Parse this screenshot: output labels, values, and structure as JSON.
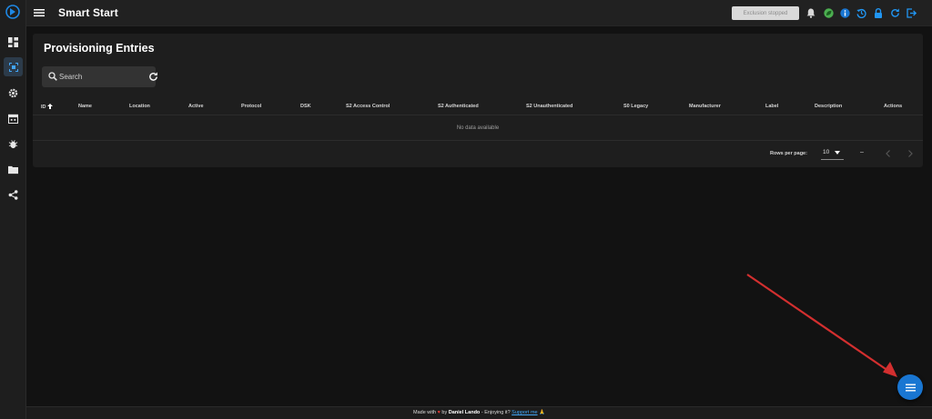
{
  "app": {
    "title": "Smart Start"
  },
  "topbar": {
    "exclusion_label": "Exclusion stopped",
    "icons": [
      "bell-icon",
      "leaf-icon",
      "info-icon",
      "history-icon",
      "lock-icon",
      "refresh-icon",
      "logout-icon"
    ],
    "colors": {
      "leaf": "#4caf50",
      "info": "#1976d2",
      "accent": "#2196f3"
    }
  },
  "sidebar": {
    "items": [
      {
        "icon": "dashboard-icon",
        "active": false
      },
      {
        "icon": "smart-start-icon",
        "active": true
      },
      {
        "icon": "settings-icon",
        "active": false
      },
      {
        "icon": "calendar-icon",
        "active": false
      },
      {
        "icon": "debug-icon",
        "active": false
      },
      {
        "icon": "folder-icon",
        "active": false
      },
      {
        "icon": "share-icon",
        "active": false
      }
    ]
  },
  "main": {
    "title": "Provisioning Entries",
    "search_placeholder": "Search",
    "columns": [
      "ID",
      "Name",
      "Location",
      "Active",
      "Protocol",
      "DSK",
      "S2 Access Control",
      "S2 Authenticated",
      "S2 Unauthenticated",
      "S0 Legacy",
      "Manufacturer",
      "Label",
      "Description",
      "Actions"
    ],
    "empty_text": "No data available",
    "rows_per_page_label": "Rows per page:",
    "rows_per_page_value": "10",
    "range_text": "–"
  },
  "footer": {
    "made_with": "Made with",
    "by": "by",
    "author": "Daniel Lando",
    "enjoying": "- Enjoying it?",
    "support_link": "Support me",
    "support_emoji": "🙏"
  }
}
